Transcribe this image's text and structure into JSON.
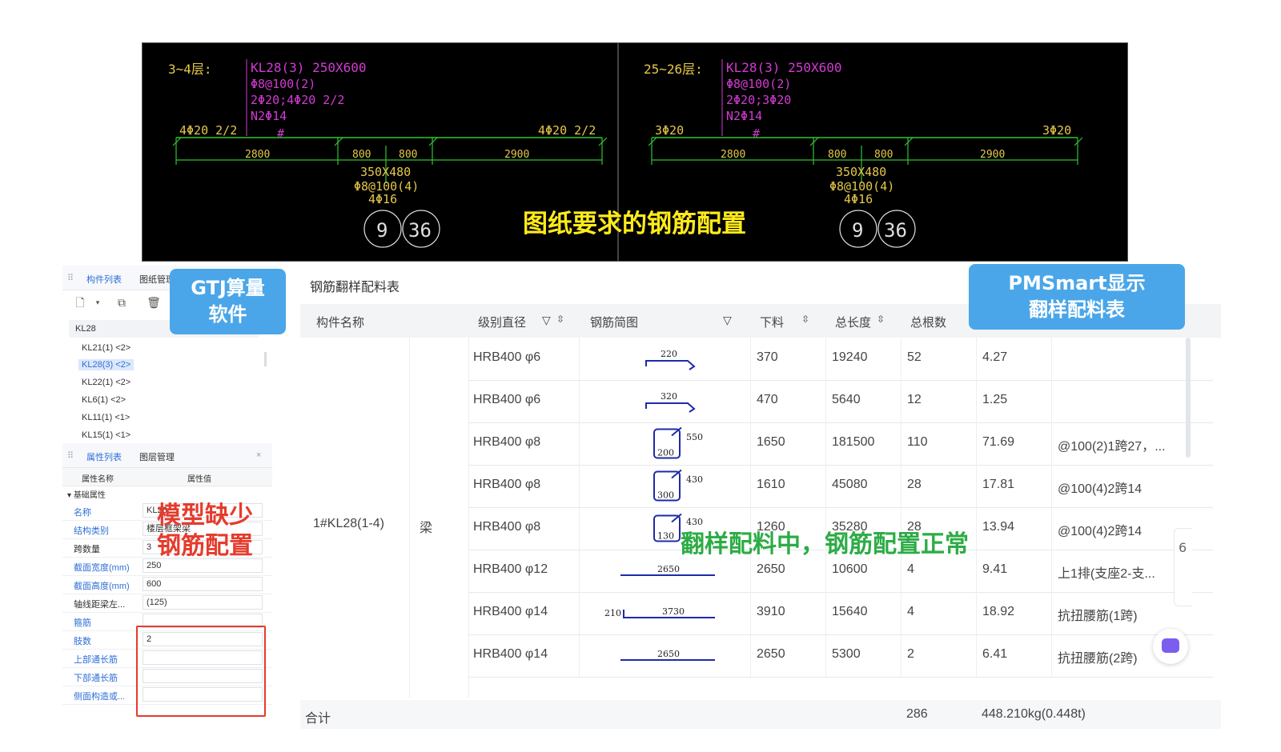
{
  "cad": {
    "left": {
      "floor": "3~4层:",
      "beam": "KL28(3) 250X600",
      "stirrup": "Φ8@100(2)",
      "top_bars": "2Φ20;4Φ20 2/2",
      "side": "N2Φ14",
      "left_support": "4Φ20 2/2",
      "right_support": "4Φ20 2/2",
      "spans": [
        "2800",
        "800",
        "800",
        "2900"
      ],
      "col_size": "350X480",
      "col_stirrup": "Φ8@100(4)",
      "col_bars": "4Φ16",
      "axis1": "9",
      "axis2": "36"
    },
    "right": {
      "floor": "25~26层:",
      "beam": "KL28(3) 250X600",
      "stirrup": "Φ8@100(2)",
      "top_bars": "2Φ20;3Φ20",
      "side": "N2Φ14",
      "left_support": "3Φ20",
      "right_support": "3Φ20",
      "spans": [
        "2800",
        "800",
        "800",
        "2900"
      ],
      "col_size": "350X480",
      "col_stirrup": "Φ8@100(4)",
      "col_bars": "4Φ16",
      "axis1": "9",
      "axis2": "36"
    },
    "caption": "图纸要求的钢筋配置"
  },
  "gtj": {
    "tabs": [
      "构件列表",
      "图纸管理"
    ],
    "search_value": "KL28",
    "components": [
      "KL21(1) <2>",
      "KL28(3) <2>",
      "KL22(1) <2>",
      "KL6(1) <2>",
      "KL11(1) <1>",
      "KL15(1) <1>"
    ],
    "prop_tabs": [
      "属性列表",
      "图层管理"
    ],
    "col_name": "属性名称",
    "col_value": "属性值",
    "group": "基础属性",
    "props": [
      {
        "name": "名称",
        "value": "KL28"
      },
      {
        "name": "结构类别",
        "value": "楼层框架梁"
      },
      {
        "name": "跨数量",
        "value": "3"
      },
      {
        "name": "截面宽度(mm)",
        "value": "250"
      },
      {
        "name": "截面高度(mm)",
        "value": "600"
      },
      {
        "name": "轴线距梁左...",
        "value": "(125)"
      },
      {
        "name": "箍筋",
        "value": ""
      },
      {
        "name": "肢数",
        "value": "2"
      },
      {
        "name": "上部通长筋",
        "value": ""
      },
      {
        "name": "下部通长筋",
        "value": ""
      },
      {
        "name": "侧面构造或...",
        "value": ""
      }
    ]
  },
  "labels": {
    "gtj_callout": "GTJ算量\n软件",
    "pms_callout": "PMSmart显示\n翻样配料表",
    "missing": "模型缺少\n钢筋配置",
    "normal": "翻样配料中，钢筋配置正常"
  },
  "table": {
    "title": "钢筋翻样配料表",
    "headers": [
      "构件名称",
      "级别直径",
      "钢筋简图",
      "下料",
      "总长度",
      "总根数"
    ],
    "component": "1#KL28(1-4)",
    "type": "梁",
    "rows": [
      {
        "grade": "HRB400 φ6",
        "shape": "hook",
        "dim": "220",
        "cut": "370",
        "total": "19240",
        "count": "52",
        "weight": "4.27",
        "note": ""
      },
      {
        "grade": "HRB400 φ6",
        "shape": "hook",
        "dim": "320",
        "cut": "470",
        "total": "5640",
        "count": "12",
        "weight": "1.25",
        "note": ""
      },
      {
        "grade": "HRB400 φ8",
        "shape": "stirrup",
        "dim": "550",
        "dim2": "200",
        "cut": "1650",
        "total": "181500",
        "count": "110",
        "weight": "71.69",
        "note": "@100(2)1跨27，..."
      },
      {
        "grade": "HRB400 φ8",
        "shape": "stirrup",
        "dim": "430",
        "dim2": "300",
        "cut": "1610",
        "total": "45080",
        "count": "28",
        "weight": "17.81",
        "note": "@100(4)2跨14"
      },
      {
        "grade": "HRB400 φ8",
        "shape": "stirrup-s",
        "dim": "430",
        "dim2": "130",
        "cut": "1260",
        "total": "35280",
        "count": "28",
        "weight": "13.94",
        "note": "@100(4)2跨14"
      },
      {
        "grade": "HRB400 φ12",
        "shape": "line",
        "dim": "2650",
        "cut": "2650",
        "total": "10600",
        "count": "4",
        "weight": "9.41",
        "note": "上1排(支座2-支..."
      },
      {
        "grade": "HRB400 φ14",
        "shape": "lhook",
        "dim": "3730",
        "dim2": "210",
        "cut": "3910",
        "total": "15640",
        "count": "4",
        "weight": "18.92",
        "note": "抗扭腰筋(1跨)"
      },
      {
        "grade": "HRB400 φ14",
        "shape": "line",
        "dim": "2650",
        "cut": "2650",
        "total": "5300",
        "count": "2",
        "weight": "6.41",
        "note": "抗扭腰筋(2跨)"
      }
    ],
    "footer": {
      "label": "合计",
      "count": "286",
      "weight": "448.210kg(0.448t)"
    }
  }
}
